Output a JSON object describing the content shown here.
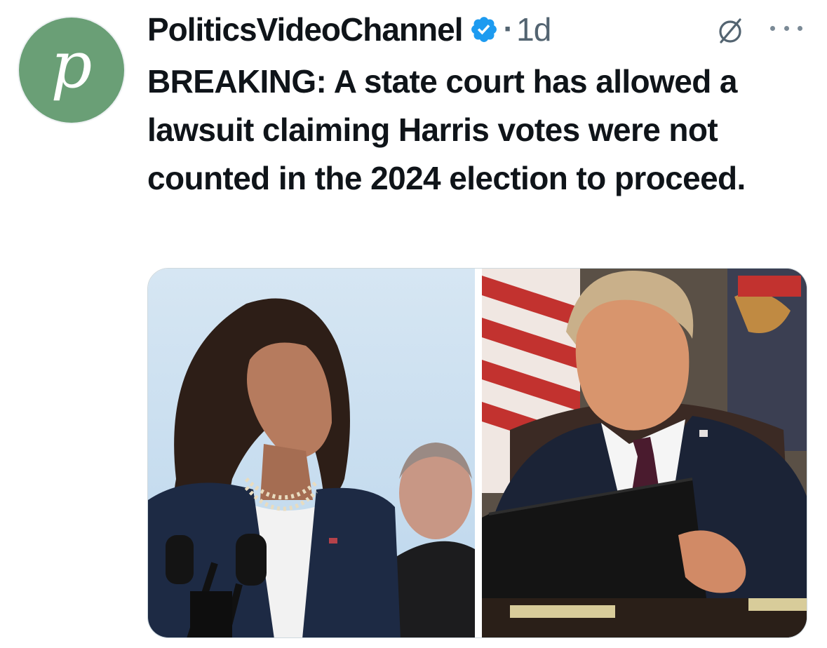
{
  "author": {
    "avatar_letter": "p",
    "display_name": "PoliticsVideoChannel",
    "verified": true,
    "separator": "·",
    "timestamp": "1d"
  },
  "icons": {
    "verified": "verified-badge-icon",
    "grok": "grok-icon",
    "more": "more-options-icon"
  },
  "tweet": {
    "text": "BREAKING: A state court has allowed a lawsuit claiming Harris votes were not counted in the 2024 election to proceed."
  },
  "media": [
    {
      "alt_kind": "photo-woman-speaking-at-podium"
    },
    {
      "alt_kind": "photo-man-seated-at-desk-with-folder"
    }
  ],
  "colors": {
    "avatar_bg": "#6a9f76",
    "verified_blue": "#1d9bf0",
    "text_primary": "#0f1419",
    "text_secondary": "#536471"
  }
}
